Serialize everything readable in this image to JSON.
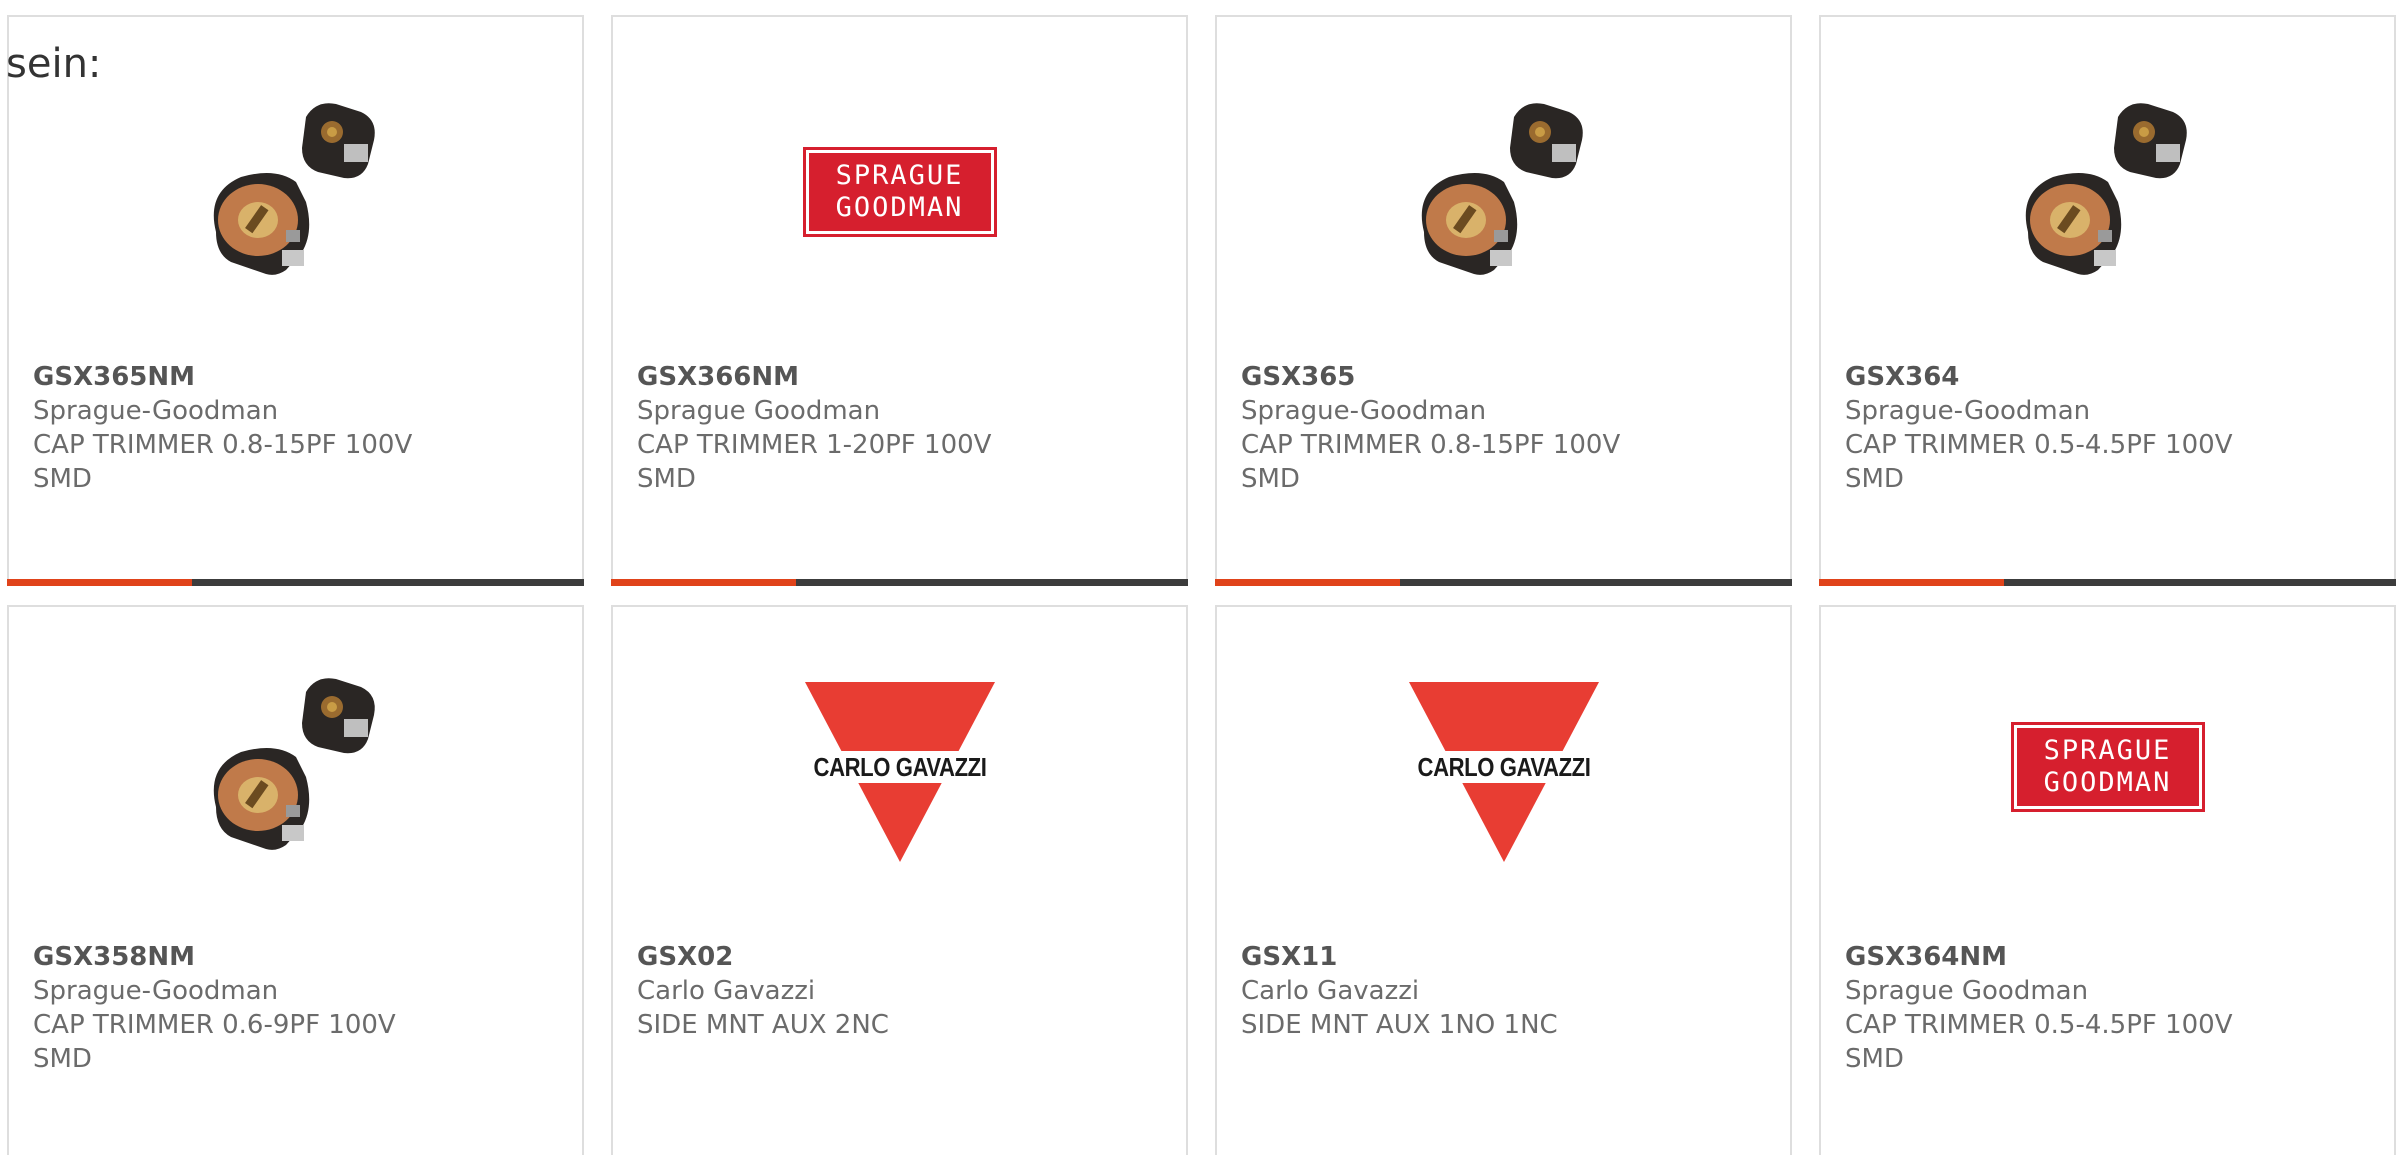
{
  "lead_text": "sein:",
  "colors": {
    "progress_fill": "#e0431a",
    "progress_track": "#3c3c3c",
    "sg_red": "#d61f2e",
    "cg_red": "#e83d33"
  },
  "products": [
    {
      "part": "GSX365NM",
      "manufacturer": "Sprague-Goodman",
      "desc1": "CAP TRIMMER 0.8-15PF 100V",
      "desc2": "SMD",
      "image": "trimmer-capacitor-photo",
      "progress": 0.32
    },
    {
      "part": "GSX366NM",
      "manufacturer": "Sprague Goodman",
      "desc1": "CAP TRIMMER 1-20PF 100V SMD",
      "desc2": "",
      "image": "sprague-goodman-logo",
      "logo_line1": "SPRAGUE",
      "logo_line2": "GOODMAN",
      "progress": 0.32
    },
    {
      "part": "GSX365",
      "manufacturer": "Sprague-Goodman",
      "desc1": "CAP TRIMMER 0.8-15PF 100V",
      "desc2": "SMD",
      "image": "trimmer-capacitor-photo",
      "progress": 0.32
    },
    {
      "part": "GSX364",
      "manufacturer": "Sprague-Goodman",
      "desc1": "CAP TRIMMER 0.5-4.5PF 100V",
      "desc2": "SMD",
      "image": "trimmer-capacitor-photo",
      "progress": 0.32
    },
    {
      "part": "GSX358NM",
      "manufacturer": "Sprague-Goodman",
      "desc1": "CAP TRIMMER 0.6-9PF 100V SMD",
      "desc2": "",
      "image": "trimmer-capacitor-photo"
    },
    {
      "part": "GSX02",
      "manufacturer": "Carlo Gavazzi",
      "desc1": "SIDE MNT AUX 2NC",
      "desc2": "",
      "image": "carlo-gavazzi-logo",
      "logo_text": "CARLO GAVAZZI"
    },
    {
      "part": "GSX11",
      "manufacturer": "Carlo Gavazzi",
      "desc1": "SIDE MNT AUX 1NO 1NC",
      "desc2": "",
      "image": "carlo-gavazzi-logo",
      "logo_text": "CARLO GAVAZZI"
    },
    {
      "part": "GSX364NM",
      "manufacturer": "Sprague Goodman",
      "desc1": "CAP TRIMMER 0.5-4.5PF 100V",
      "desc2": "SMD",
      "image": "sprague-goodman-logo",
      "logo_line1": "SPRAGUE",
      "logo_line2": "GOODMAN"
    }
  ]
}
